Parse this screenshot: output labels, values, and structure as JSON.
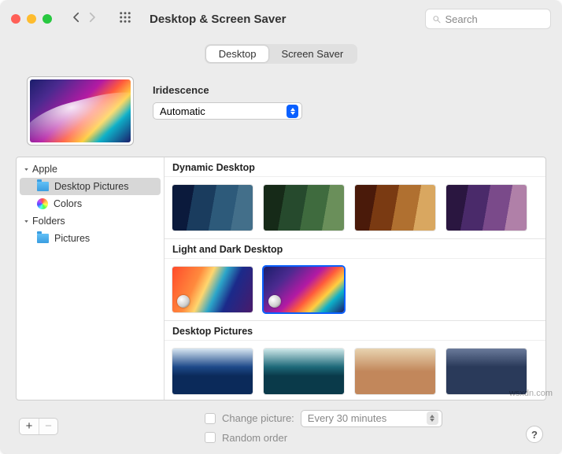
{
  "header": {
    "title": "Desktop & Screen Saver",
    "search_placeholder": "Search"
  },
  "tabs": [
    {
      "label": "Desktop",
      "active": true
    },
    {
      "label": "Screen Saver",
      "active": false
    }
  ],
  "preview": {
    "wallpaper_name": "Iridescence",
    "mode_select": "Automatic"
  },
  "sidebar": {
    "groups": [
      {
        "label": "Apple",
        "items": [
          {
            "label": "Desktop Pictures",
            "icon": "folder",
            "selected": true
          },
          {
            "label": "Colors",
            "icon": "colors",
            "selected": false
          }
        ]
      },
      {
        "label": "Folders",
        "items": [
          {
            "label": "Pictures",
            "icon": "folder",
            "selected": false
          }
        ]
      }
    ]
  },
  "gallery": {
    "sections": [
      {
        "title": "Dynamic Desktop"
      },
      {
        "title": "Light and Dark Desktop"
      },
      {
        "title": "Desktop Pictures"
      }
    ]
  },
  "footer": {
    "change_picture_label": "Change picture:",
    "interval_select": "Every 30 minutes",
    "random_order_label": "Random order"
  },
  "watermark": "wsxdn.com"
}
